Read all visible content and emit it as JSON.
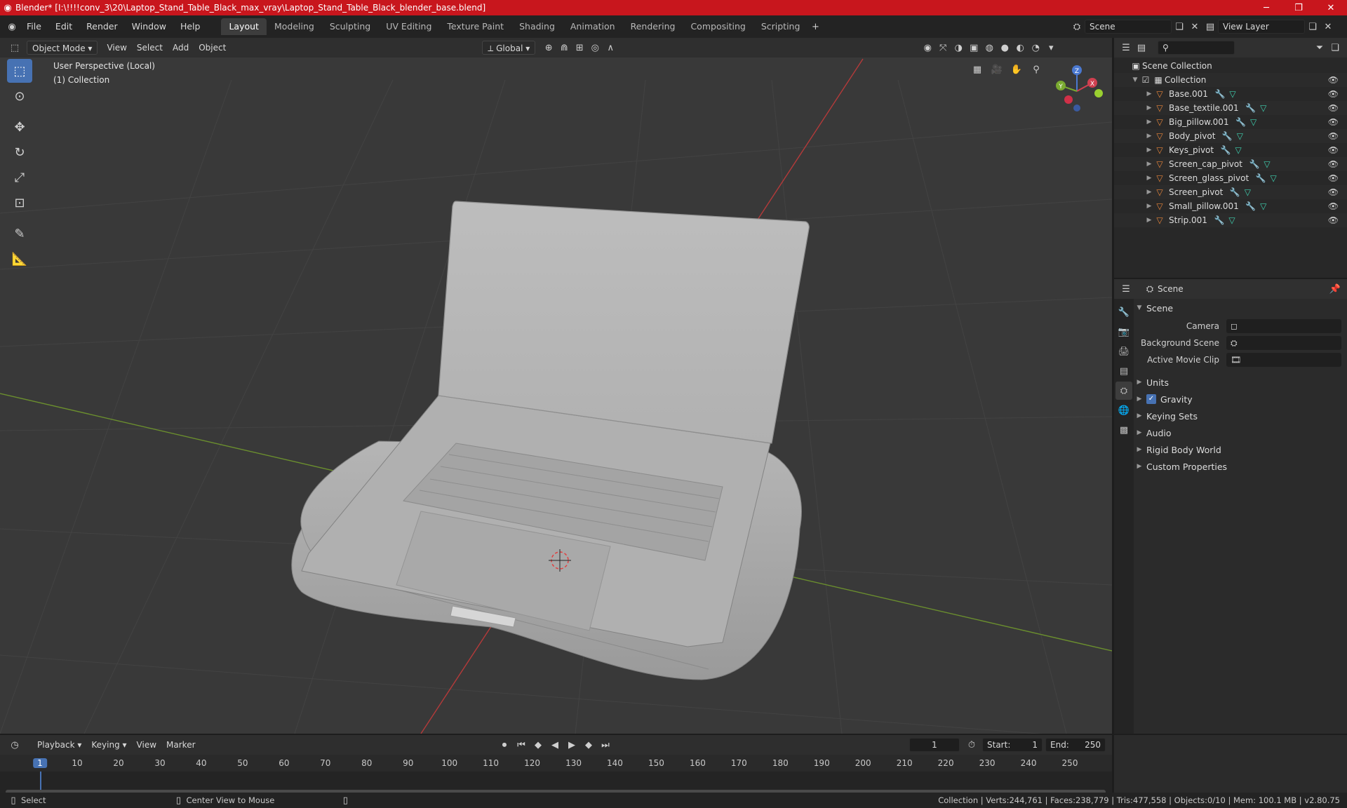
{
  "titlebar": {
    "title": "Blender* [I:\\!!!!conv_3\\20\\Laptop_Stand_Table_Black_max_vray\\Laptop_Stand_Table_Black_blender_base.blend]"
  },
  "menu": [
    "File",
    "Edit",
    "Render",
    "Window",
    "Help"
  ],
  "workspaces": [
    "Layout",
    "Modeling",
    "Sculpting",
    "UV Editing",
    "Texture Paint",
    "Shading",
    "Animation",
    "Rendering",
    "Compositing",
    "Scripting"
  ],
  "active_workspace": "Layout",
  "scene_field": "Scene",
  "view_layer_field": "View Layer",
  "viewport": {
    "mode": "Object Mode",
    "menus": [
      "View",
      "Select",
      "Add",
      "Object"
    ],
    "transform_orientation": "Global",
    "info_line1": "User Perspective (Local)",
    "info_line2": "(1) Collection",
    "gizmo_x": "X",
    "gizmo_y": "Y",
    "gizmo_z": "Z"
  },
  "outliner": {
    "root": "Scene Collection",
    "collection": "Collection",
    "objects": [
      "Base.001",
      "Base_textile.001",
      "Big_pillow.001",
      "Body_pivot",
      "Keys_pivot",
      "Screen_cap_pivot",
      "Screen_glass_pivot",
      "Screen_pivot",
      "Small_pillow.001",
      "Strip.001"
    ]
  },
  "properties": {
    "header": "Scene",
    "section": "Scene",
    "fields": [
      {
        "label": "Camera"
      },
      {
        "label": "Background Scene"
      },
      {
        "label": "Active Movie Clip"
      }
    ],
    "subsections": [
      "Units",
      "Gravity",
      "Keying Sets",
      "Audio",
      "Rigid Body World",
      "Custom Properties"
    ]
  },
  "timeline": {
    "menus": [
      "Playback",
      "Keying",
      "View",
      "Marker"
    ],
    "current_frame": "1",
    "start_label": "Start:",
    "start": "1",
    "end_label": "End:",
    "end": "250",
    "ticks": [
      "1",
      "10",
      "20",
      "30",
      "40",
      "50",
      "60",
      "70",
      "80",
      "90",
      "100",
      "110",
      "120",
      "130",
      "140",
      "150",
      "160",
      "170",
      "180",
      "190",
      "200",
      "210",
      "220",
      "230",
      "240",
      "250"
    ]
  },
  "statusbar": {
    "left": "Select",
    "middle": "Center View to Mouse",
    "right": "Collection | Verts:244,761 | Faces:238,779 | Tris:477,558 | Objects:0/10 | Mem: 100.1 MB | v2.80.75"
  },
  "colors": {
    "accent": "#4772b3",
    "titlebar": "#c8161d",
    "object_icon": "#e8853a",
    "modifier_icon": "#7aa2ff",
    "mesh_icon": "#3fd1b0"
  }
}
